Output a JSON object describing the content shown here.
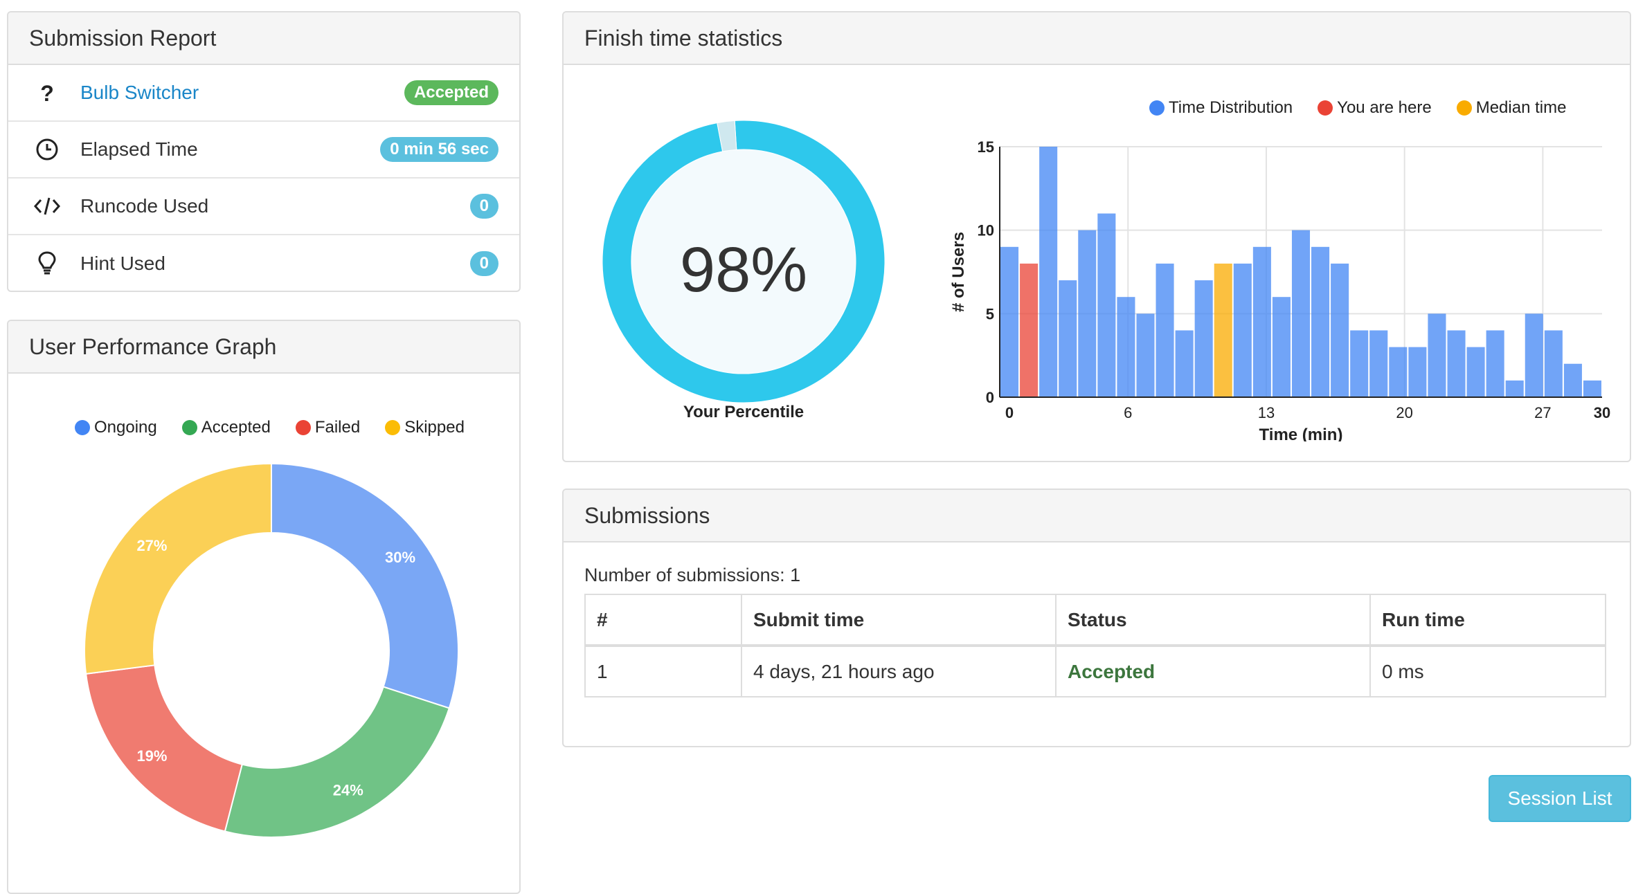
{
  "report": {
    "title": "Submission Report",
    "rows": [
      {
        "icon": "question-icon",
        "label": "Bulb Switcher",
        "badge": "Accepted",
        "badge_color": "#5cb85c"
      },
      {
        "icon": "clock-icon",
        "label": "Elapsed Time",
        "badge": "0 min 56 sec",
        "badge_color": "#5bc0de"
      },
      {
        "icon": "code-icon",
        "label": "Runcode Used",
        "badge": "0",
        "badge_color": "#5bc0de"
      },
      {
        "icon": "lightbulb-icon",
        "label": "Hint Used",
        "badge": "0",
        "badge_color": "#5bc0de"
      }
    ]
  },
  "perf": {
    "title": "User Performance Graph",
    "legend": [
      {
        "label": "Ongoing",
        "color": "#4285f4"
      },
      {
        "label": "Accepted",
        "color": "#34a853"
      },
      {
        "label": "Failed",
        "color": "#ea4335"
      },
      {
        "label": "Skipped",
        "color": "#fbbc05"
      }
    ]
  },
  "finish": {
    "title": "Finish time statistics",
    "percentile_value": "98%",
    "percentile_label": "Your Percentile",
    "legend": [
      {
        "label": "Time Distribution",
        "color": "#4285f4"
      },
      {
        "label": "You are here",
        "color": "#ea4335"
      },
      {
        "label": "Median time",
        "color": "#f9ab00"
      }
    ]
  },
  "submissions": {
    "title": "Submissions",
    "count_text": "Number of submissions: 1",
    "headers": [
      "#",
      "Submit time",
      "Status",
      "Run time"
    ],
    "rows": [
      {
        "num": "1",
        "time": "4 days, 21 hours ago",
        "status": "Accepted",
        "runtime": "0 ms"
      }
    ]
  },
  "session_button": "Session List",
  "chart_data": [
    {
      "type": "pie",
      "categories": [
        "Ongoing",
        "Accepted",
        "Failed",
        "Skipped"
      ],
      "values": [
        30,
        24,
        19,
        27
      ],
      "data_labels": [
        "30%",
        "24%",
        "19%",
        "27%"
      ],
      "colors": [
        "#7aa7f5",
        "#70c386",
        "#f07b70",
        "#fbd056"
      ],
      "donut": true
    },
    {
      "type": "pie",
      "categories": [
        "Your Percentile",
        "Remaining"
      ],
      "values": [
        98,
        2
      ],
      "colors": [
        "#2ec8ec",
        "#cfe8ef"
      ],
      "donut": true,
      "center_label": "98%"
    },
    {
      "type": "bar",
      "xlabel": "Time (min)",
      "ylabel": "# of Users",
      "ylim": [
        0,
        15
      ],
      "xlim": [
        0,
        30
      ],
      "x_ticks": [
        "0",
        "6",
        "13",
        "20",
        "27",
        "30"
      ],
      "y_ticks": [
        "0",
        "5",
        "10",
        "15"
      ],
      "grid": true,
      "legend_position": "top",
      "series": [
        {
          "name": "Time Distribution",
          "color": "#4285f4"
        },
        {
          "name": "You are here",
          "color": "#ea4335"
        },
        {
          "name": "Median time",
          "color": "#f9ab00"
        }
      ],
      "values": [
        9,
        8,
        15,
        7,
        10,
        11,
        6,
        5,
        8,
        4,
        7,
        8,
        8,
        9,
        6,
        10,
        9,
        8,
        4,
        4,
        3,
        3,
        5,
        4,
        3,
        4,
        1,
        5,
        4,
        2,
        1
      ],
      "highlight": {
        "you_are_here_index": 1,
        "median_index": 11
      }
    }
  ]
}
